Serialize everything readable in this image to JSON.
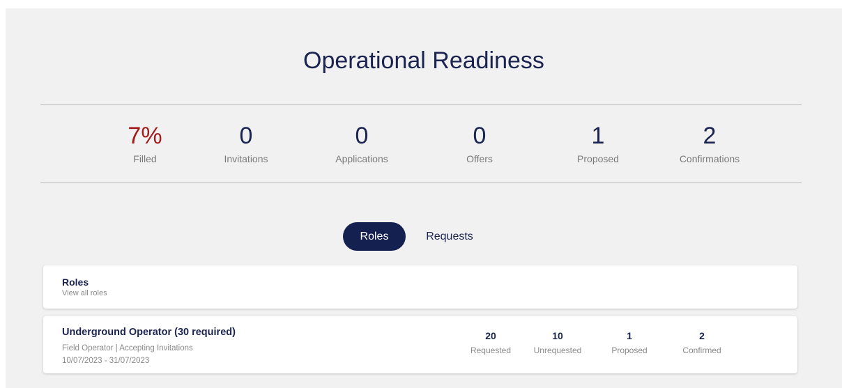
{
  "page": {
    "title": "Operational Readiness"
  },
  "stats": [
    {
      "value": "7%",
      "label": "Filled"
    },
    {
      "value": "0",
      "label": "Invitations"
    },
    {
      "value": "0",
      "label": "Applications"
    },
    {
      "value": "0",
      "label": "Offers"
    },
    {
      "value": "1",
      "label": "Proposed"
    },
    {
      "value": "2",
      "label": "Confirmations"
    }
  ],
  "tabs": [
    {
      "label": "Roles",
      "active": true
    },
    {
      "label": "Requests",
      "active": false
    }
  ],
  "roles_card": {
    "title": "Roles",
    "subtitle": "View all roles"
  },
  "role": {
    "title": "Underground Operator (30 required)",
    "type": "Field Operator",
    "separator": "|",
    "status": "Accepting Invitations",
    "dates": "10/07/2023 - 31/07/2023",
    "stats": [
      {
        "value": "20",
        "label": "Requested"
      },
      {
        "value": "10",
        "label": "Unrequested"
      },
      {
        "value": "1",
        "label": "Proposed"
      },
      {
        "value": "2",
        "label": "Confirmed"
      }
    ]
  },
  "colors": {
    "accent": "#14204f",
    "filled": "#a31b1b",
    "background": "#f1f1f1"
  }
}
